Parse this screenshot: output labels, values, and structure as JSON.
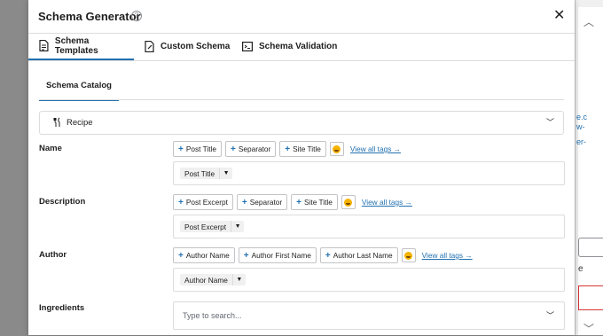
{
  "modal": {
    "title": "Schema Generator",
    "close_symbol": "✕",
    "help_symbol": "?"
  },
  "tabs": [
    {
      "label": "Schema Templates",
      "icon": "document-icon",
      "active": true
    },
    {
      "label": "Custom Schema",
      "icon": "custom-doc-icon",
      "active": false
    },
    {
      "label": "Schema Validation",
      "icon": "terminal-icon",
      "active": false
    }
  ],
  "catalog": {
    "tab_label": "Schema Catalog"
  },
  "schema_type": {
    "value": "Recipe",
    "icon": "recipe-icon"
  },
  "fields": [
    {
      "label": "Name",
      "tags": [
        "Post Title",
        "Separator",
        "Site Title"
      ],
      "view_all": "View all tags →",
      "value": "Post Title"
    },
    {
      "label": "Description",
      "tags": [
        "Post Excerpt",
        "Separator",
        "Site Title"
      ],
      "view_all": "View all tags →",
      "value": "Post Excerpt"
    },
    {
      "label": "Author",
      "tags": [
        "Author Name",
        "Author First Name",
        "Author Last Name"
      ],
      "view_all": "View all tags →",
      "value": "Author Name"
    }
  ],
  "ingredients": {
    "label": "Ingredients",
    "placeholder": "Type to search..."
  },
  "background": {
    "link_lines": [
      "e.c",
      "w-",
      "",
      "er-"
    ],
    "text": "e"
  },
  "colors": {
    "accent": "#2271b1",
    "border": "#dcdcde",
    "emoji": "#f5b301"
  }
}
